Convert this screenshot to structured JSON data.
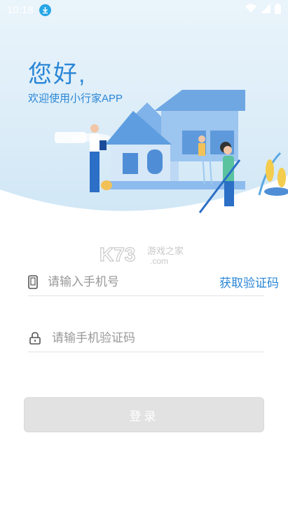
{
  "status_bar": {
    "time": "10:18",
    "icons": [
      "download-icon",
      "wifi-icon",
      "signal-icon",
      "battery-icon"
    ]
  },
  "hero": {
    "greeting": "您好,",
    "subtitle": "欢迎使用小行家APP"
  },
  "watermark": {
    "logo_text": "K73",
    "site_name": "游戏之家",
    "domain": ".com"
  },
  "form": {
    "phone_placeholder": "请输入手机号",
    "get_code_label": "获取验证码",
    "code_placeholder": "请输手机验证码",
    "login_label": "登录"
  },
  "colors": {
    "accent": "#2a86d6",
    "button_disabled": "#e2e2e2",
    "hero_background": "#dcedf8"
  }
}
